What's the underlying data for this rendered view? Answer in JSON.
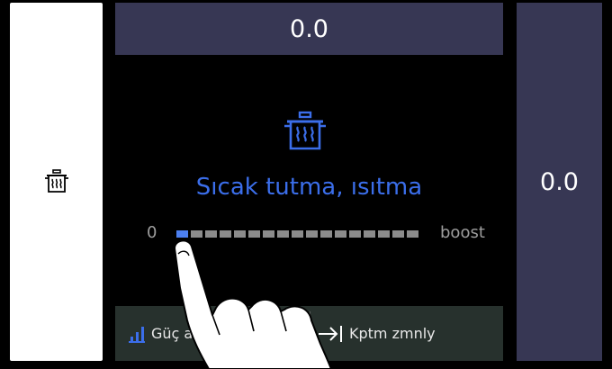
{
  "left_zone": {
    "icon": "keep-warm-pot-icon"
  },
  "top_bar": {
    "value": "0.0"
  },
  "right_zone": {
    "value": "0.0"
  },
  "main": {
    "icon": "keep-warm-pot-icon",
    "title": "Sıcak tutma, ısıtma",
    "level": {
      "min_label": "0",
      "max_label": "boost",
      "segments_total": 17,
      "selected_segment": 1
    }
  },
  "bottom_bar": {
    "power_label": "Güç a",
    "power_icon": "power-bars-icon",
    "timer_label": "Kptm zmnly",
    "timer_icon": "arrow-to-bar-icon"
  },
  "overlay": {
    "icon": "pointing-hand-icon"
  },
  "colors": {
    "accent_blue": "#3b6eea",
    "panel": "#373754",
    "bottom_bar": "#27312d",
    "segment_inactive": "#8c8c8c",
    "segment_active": "#4c7ff0"
  }
}
